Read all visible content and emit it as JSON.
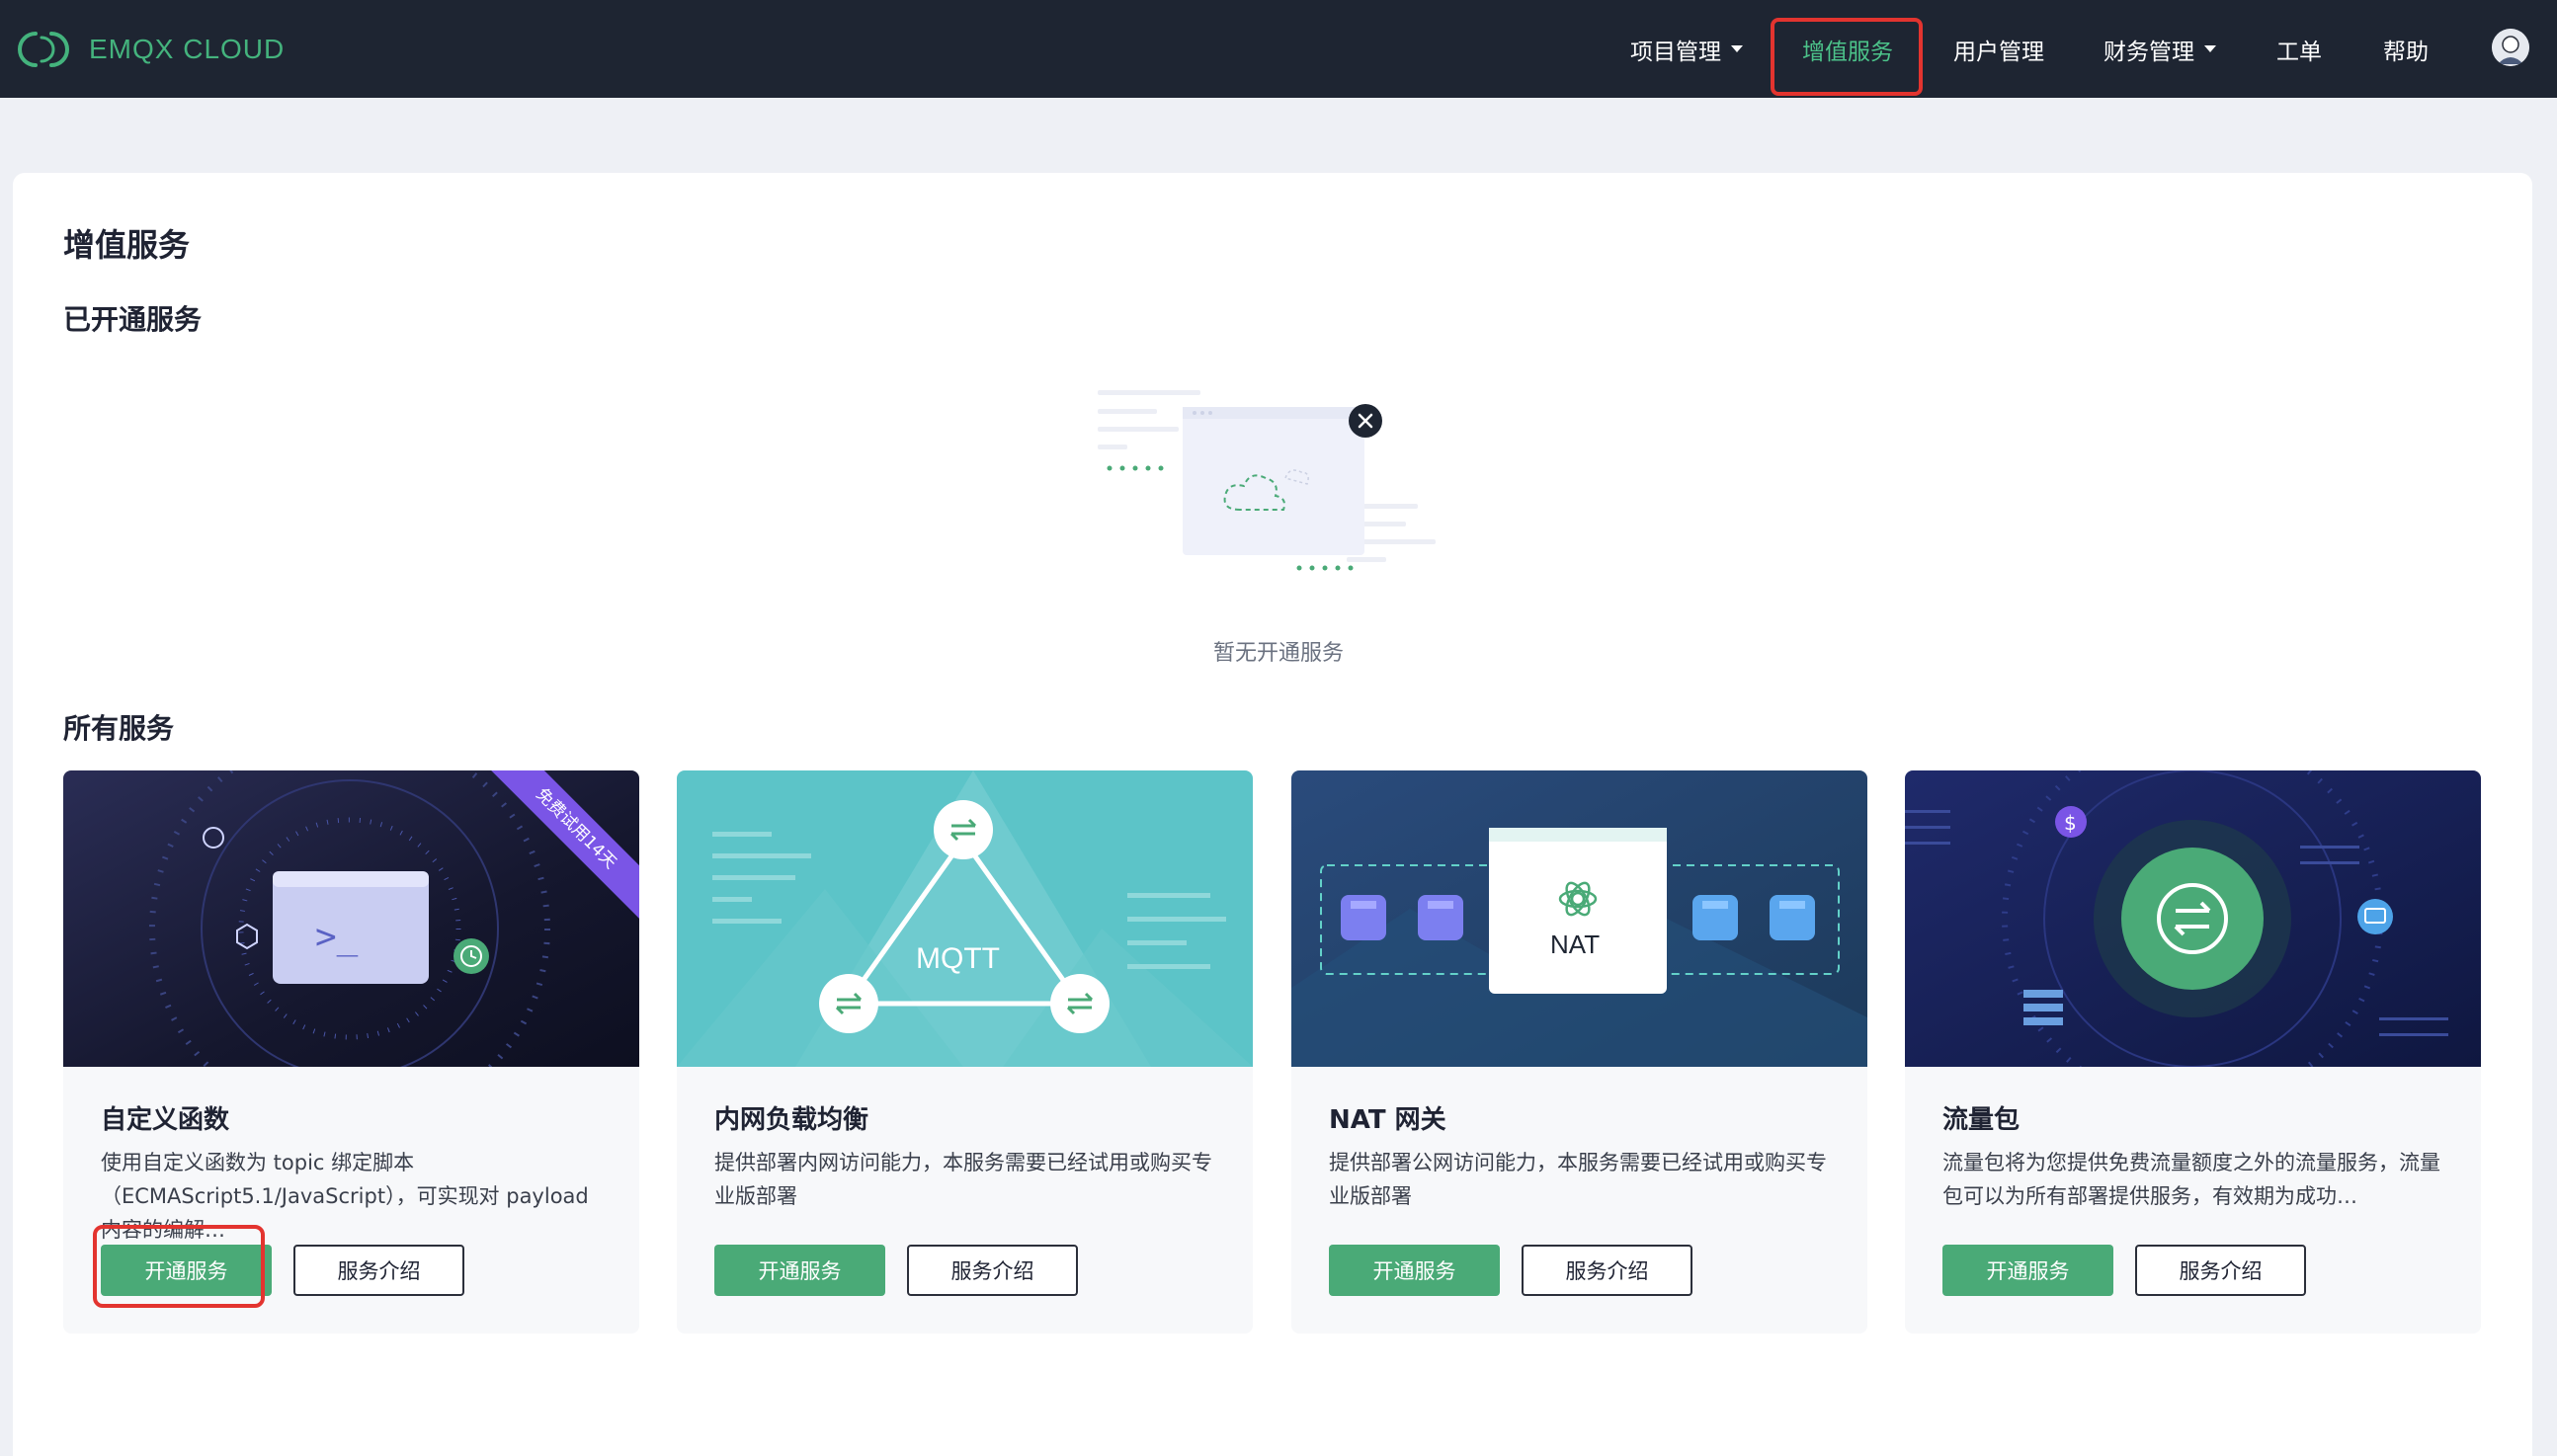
{
  "app": {
    "brand": "EMQX CLOUD"
  },
  "nav": {
    "items": [
      {
        "label": "项目管理",
        "has_dropdown": true
      },
      {
        "label": "增值服务",
        "has_dropdown": false,
        "active": true
      },
      {
        "label": "用户管理",
        "has_dropdown": false
      },
      {
        "label": "财务管理",
        "has_dropdown": true
      },
      {
        "label": "工单",
        "has_dropdown": false
      },
      {
        "label": "帮助",
        "has_dropdown": false
      }
    ]
  },
  "page": {
    "title": "增值服务",
    "enabled_section": "已开通服务",
    "empty_text": "暂无开通服务",
    "all_section": "所有服务"
  },
  "services": [
    {
      "title": "自定义函数",
      "desc": "使用自定义函数为 topic 绑定脚本（ECMAScript5.1/JavaScript），可实现对 payload 内容的编解…",
      "badge": "免费试用14天",
      "enable_label": "开通服务",
      "intro_label": "服务介绍"
    },
    {
      "title": "内网负载均衡",
      "desc": "提供部署内网访问能力，本服务需要已经试用或购买专业版部署",
      "image_text": "MQTT",
      "enable_label": "开通服务",
      "intro_label": "服务介绍"
    },
    {
      "title": "NAT 网关",
      "desc": "提供部署公网访问能力，本服务需要已经试用或购买专业版部署",
      "image_text": "NAT",
      "enable_label": "开通服务",
      "intro_label": "服务介绍"
    },
    {
      "title": "流量包",
      "desc": "流量包将为您提供免费流量额度之外的流量服务，流量包可以为所有部署提供服务，有效期为成功…",
      "enable_label": "开通服务",
      "intro_label": "服务介绍"
    }
  ],
  "colors": {
    "topbar": "#1e2532",
    "accent": "#4cc38a",
    "primary_button": "#4aaa77",
    "highlight": "#e3342f",
    "ribbon": "#7a55e6"
  },
  "icons": [
    "emqx-logo-icon",
    "caret-down-icon",
    "user-avatar-icon",
    "empty-cloud-icon",
    "close-icon",
    "terminal-icon",
    "clock-icon",
    "swap-icon",
    "nat-icon",
    "dollar-icon"
  ]
}
